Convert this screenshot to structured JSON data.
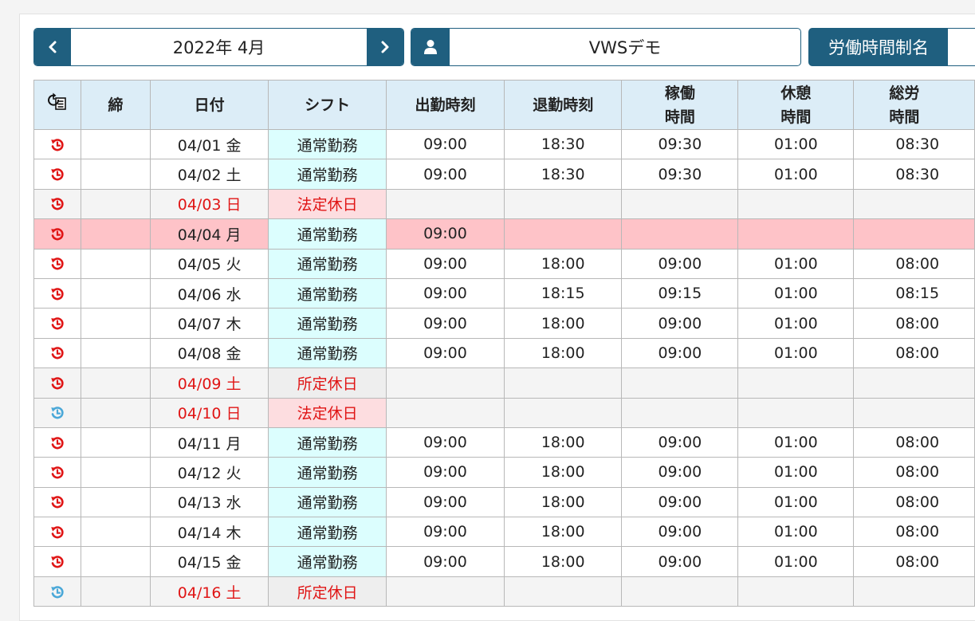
{
  "toolbar": {
    "month": "2022年 4月",
    "user": "VWSデモ",
    "law_label": "労働時間制名"
  },
  "table": {
    "headers": {
      "close": "締",
      "date": "日付",
      "shift": "シフト",
      "in": "出勤時刻",
      "out": "退勤時刻",
      "work_1": "稼働",
      "work_2": "時間",
      "break_1": "休憩",
      "break_2": "時間",
      "total_1": "総労",
      "total_2": "時間"
    },
    "rows": [
      {
        "icon": "red",
        "date": "04/01 金",
        "shift": "通常勤務",
        "shift_type": "normal",
        "in": "09:00",
        "out": "18:30",
        "work": "09:30",
        "break": "01:00",
        "total": "08:30",
        "row_type": "normal"
      },
      {
        "icon": "red",
        "date": "04/02 土",
        "shift": "通常勤務",
        "shift_type": "normal",
        "in": "09:00",
        "out": "18:30",
        "work": "09:30",
        "break": "01:00",
        "total": "08:30",
        "row_type": "normal"
      },
      {
        "icon": "red",
        "date": "04/03 日",
        "shift": "法定休日",
        "shift_type": "legal",
        "in": "",
        "out": "",
        "work": "",
        "break": "",
        "total": "",
        "row_type": "holiday"
      },
      {
        "icon": "red",
        "date": "04/04 月",
        "shift": "通常勤務",
        "shift_type": "normal",
        "in": "09:00",
        "out": "",
        "work": "",
        "break": "",
        "total": "",
        "row_type": "alert"
      },
      {
        "icon": "red",
        "date": "04/05 火",
        "shift": "通常勤務",
        "shift_type": "normal",
        "in": "09:00",
        "out": "18:00",
        "work": "09:00",
        "break": "01:00",
        "total": "08:00",
        "row_type": "normal"
      },
      {
        "icon": "red",
        "date": "04/06 水",
        "shift": "通常勤務",
        "shift_type": "normal",
        "in": "09:00",
        "out": "18:15",
        "work": "09:15",
        "break": "01:00",
        "total": "08:15",
        "row_type": "normal"
      },
      {
        "icon": "red",
        "date": "04/07 木",
        "shift": "通常勤務",
        "shift_type": "normal",
        "in": "09:00",
        "out": "18:00",
        "work": "09:00",
        "break": "01:00",
        "total": "08:00",
        "row_type": "normal"
      },
      {
        "icon": "red",
        "date": "04/08 金",
        "shift": "通常勤務",
        "shift_type": "normal",
        "in": "09:00",
        "out": "18:00",
        "work": "09:00",
        "break": "01:00",
        "total": "08:00",
        "row_type": "normal"
      },
      {
        "icon": "red",
        "date": "04/09 土",
        "shift": "所定休日",
        "shift_type": "prescribed",
        "in": "",
        "out": "",
        "work": "",
        "break": "",
        "total": "",
        "row_type": "holiday"
      },
      {
        "icon": "blue",
        "date": "04/10 日",
        "shift": "法定休日",
        "shift_type": "legal",
        "in": "",
        "out": "",
        "work": "",
        "break": "",
        "total": "",
        "row_type": "holiday"
      },
      {
        "icon": "red",
        "date": "04/11 月",
        "shift": "通常勤務",
        "shift_type": "normal",
        "in": "09:00",
        "out": "18:00",
        "work": "09:00",
        "break": "01:00",
        "total": "08:00",
        "row_type": "normal"
      },
      {
        "icon": "red",
        "date": "04/12 火",
        "shift": "通常勤務",
        "shift_type": "normal",
        "in": "09:00",
        "out": "18:00",
        "work": "09:00",
        "break": "01:00",
        "total": "08:00",
        "row_type": "normal"
      },
      {
        "icon": "red",
        "date": "04/13 水",
        "shift": "通常勤務",
        "shift_type": "normal",
        "in": "09:00",
        "out": "18:00",
        "work": "09:00",
        "break": "01:00",
        "total": "08:00",
        "row_type": "normal"
      },
      {
        "icon": "red",
        "date": "04/14 木",
        "shift": "通常勤務",
        "shift_type": "normal",
        "in": "09:00",
        "out": "18:00",
        "work": "09:00",
        "break": "01:00",
        "total": "08:00",
        "row_type": "normal"
      },
      {
        "icon": "red",
        "date": "04/15 金",
        "shift": "通常勤務",
        "shift_type": "normal",
        "in": "09:00",
        "out": "18:00",
        "work": "09:00",
        "break": "01:00",
        "total": "08:00",
        "row_type": "normal"
      },
      {
        "icon": "blue",
        "date": "04/16 土",
        "shift": "所定休日",
        "shift_type": "prescribed",
        "in": "",
        "out": "",
        "work": "",
        "break": "",
        "total": "",
        "row_type": "holiday"
      }
    ]
  },
  "colors": {
    "primary": "#1f5f7f",
    "header_bg": "#dcedf7",
    "history_red": "#e01515",
    "history_blue": "#4aa8d8",
    "alert_row": "#fec3c8"
  },
  "icons": {
    "prev": "chevron-left-icon",
    "next": "chevron-right-icon",
    "user": "user-icon",
    "header": "history-document-icon",
    "row": "history-icon"
  }
}
